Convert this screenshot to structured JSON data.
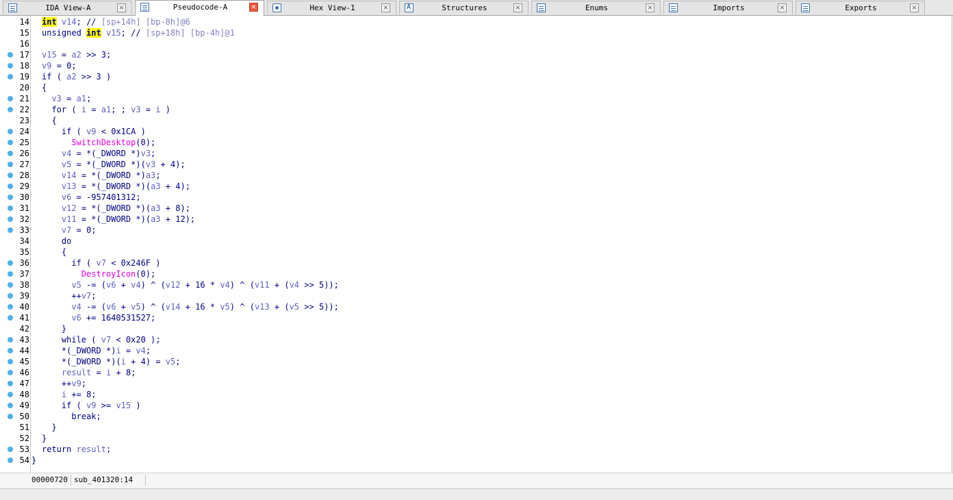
{
  "tabs": [
    {
      "label": "IDA View-A",
      "icon": "ida-view-icon",
      "active": false
    },
    {
      "label": "Pseudocode-A",
      "icon": "pseudocode-icon",
      "active": true
    },
    {
      "label": "Hex View-1",
      "icon": "hex-view-icon",
      "active": false
    },
    {
      "label": "Structures",
      "icon": "structures-icon",
      "active": false
    },
    {
      "label": "Enums",
      "icon": "enums-icon",
      "active": false
    },
    {
      "label": "Imports",
      "icon": "imports-icon",
      "active": false
    },
    {
      "label": "Exports",
      "icon": "exports-icon",
      "active": false
    }
  ],
  "close_glyph": "×",
  "code": [
    {
      "ln": "14",
      "bp": false,
      "text": "int v14; // [sp+14h] [bp-8h]@6"
    },
    {
      "ln": "15",
      "bp": false,
      "text": "unsigned int v15; // [sp+18h] [bp-4h]@1"
    },
    {
      "ln": "16",
      "bp": false,
      "text": ""
    },
    {
      "ln": "17",
      "bp": true,
      "text": "v15 = a2 >> 3;"
    },
    {
      "ln": "18",
      "bp": true,
      "text": "v9 = 0;"
    },
    {
      "ln": "19",
      "bp": true,
      "text": "if ( a2 >> 3 )"
    },
    {
      "ln": "20",
      "bp": false,
      "text": "{"
    },
    {
      "ln": "21",
      "bp": true,
      "text": "  v3 = a1;"
    },
    {
      "ln": "22",
      "bp": true,
      "text": "  for ( i = a1; ; v3 = i )"
    },
    {
      "ln": "23",
      "bp": false,
      "text": "  {"
    },
    {
      "ln": "24",
      "bp": true,
      "text": "    if ( v9 < 0x1CA )"
    },
    {
      "ln": "25",
      "bp": true,
      "text": "      SwitchDesktop(0);"
    },
    {
      "ln": "26",
      "bp": true,
      "text": "    v4 = *(_DWORD *)v3;"
    },
    {
      "ln": "27",
      "bp": true,
      "text": "    v5 = *(_DWORD *)(v3 + 4);"
    },
    {
      "ln": "28",
      "bp": true,
      "text": "    v14 = *(_DWORD *)a3;"
    },
    {
      "ln": "29",
      "bp": true,
      "text": "    v13 = *(_DWORD *)(a3 + 4);"
    },
    {
      "ln": "30",
      "bp": true,
      "text": "    v6 = -957401312;"
    },
    {
      "ln": "31",
      "bp": true,
      "text": "    v12 = *(_DWORD *)(a3 + 8);"
    },
    {
      "ln": "32",
      "bp": true,
      "text": "    v11 = *(_DWORD *)(a3 + 12);"
    },
    {
      "ln": "33",
      "bp": true,
      "text": "    v7 = 0;"
    },
    {
      "ln": "34",
      "bp": false,
      "text": "    do"
    },
    {
      "ln": "35",
      "bp": false,
      "text": "    {"
    },
    {
      "ln": "36",
      "bp": true,
      "text": "      if ( v7 < 0x246F )"
    },
    {
      "ln": "37",
      "bp": true,
      "text": "        DestroyIcon(0);"
    },
    {
      "ln": "38",
      "bp": true,
      "text": "      v5 -= (v6 + v4) ^ (v12 + 16 * v4) ^ (v11 + (v4 >> 5));"
    },
    {
      "ln": "39",
      "bp": true,
      "text": "      ++v7;"
    },
    {
      "ln": "40",
      "bp": true,
      "text": "      v4 -= (v6 + v5) ^ (v14 + 16 * v5) ^ (v13 + (v5 >> 5));"
    },
    {
      "ln": "41",
      "bp": true,
      "text": "      v6 += 1640531527;"
    },
    {
      "ln": "42",
      "bp": false,
      "text": "    }"
    },
    {
      "ln": "43",
      "bp": true,
      "text": "    while ( v7 < 0x20 );"
    },
    {
      "ln": "44",
      "bp": true,
      "text": "    *(_DWORD *)i = v4;"
    },
    {
      "ln": "45",
      "bp": true,
      "text": "    *(_DWORD *)(i + 4) = v5;"
    },
    {
      "ln": "46",
      "bp": true,
      "text": "    result = i + 8;"
    },
    {
      "ln": "47",
      "bp": true,
      "text": "    ++v9;"
    },
    {
      "ln": "48",
      "bp": true,
      "text": "    i += 8;"
    },
    {
      "ln": "49",
      "bp": true,
      "text": "    if ( v9 >= v15 )"
    },
    {
      "ln": "50",
      "bp": true,
      "text": "      break;"
    },
    {
      "ln": "51",
      "bp": false,
      "text": "  }"
    },
    {
      "ln": "52",
      "bp": false,
      "text": "}"
    },
    {
      "ln": "53",
      "bp": true,
      "text": "return result;"
    },
    {
      "ln": "54",
      "bp": true,
      "text": ""
    }
  ],
  "closing_brace": "}",
  "status": {
    "address": "00000720",
    "location": "sub_401320:14"
  },
  "colors": {
    "keyword": "#000080",
    "variable": "#6060c0",
    "comment": "#8080c0",
    "function": "#e000e0",
    "highlight": "#ffff00",
    "breakpoint_dot": "#4fb0e8"
  }
}
